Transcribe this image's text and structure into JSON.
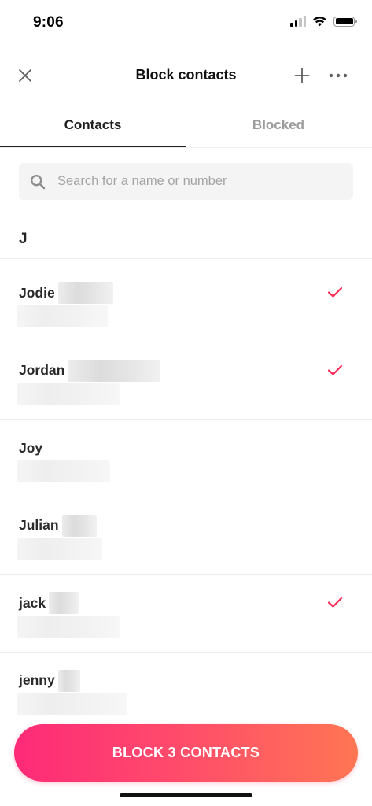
{
  "status_bar": {
    "time": "9:06",
    "icons": [
      "cellular-signal-icon",
      "wifi-icon",
      "battery-icon"
    ]
  },
  "header": {
    "title": "Block contacts",
    "close_icon": "close-icon",
    "add_icon": "plus-icon",
    "more_icon": "more-horizontal-icon"
  },
  "tabs": [
    {
      "label": "Contacts",
      "active": true
    },
    {
      "label": "Blocked",
      "active": false
    }
  ],
  "search": {
    "placeholder": "Search for a name or number",
    "value": "",
    "icon": "search-icon"
  },
  "section": {
    "letter": "J"
  },
  "contacts": [
    {
      "name": "Jodie",
      "selected": true
    },
    {
      "name": "Jordan",
      "selected": true
    },
    {
      "name": "Joy",
      "selected": false
    },
    {
      "name": "Julian",
      "selected": false
    },
    {
      "name": "jack",
      "selected": true
    },
    {
      "name": "jenny",
      "selected": false
    }
  ],
  "block_button": {
    "label": "BLOCK 3 CONTACTS"
  },
  "colors": {
    "accent": "#fe2c55",
    "gradient_start": "#fe2a78",
    "gradient_end": "#ff7653",
    "checkmark": "#fe2c55"
  }
}
